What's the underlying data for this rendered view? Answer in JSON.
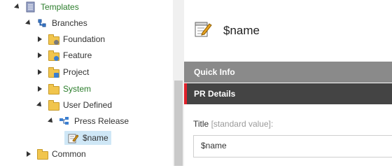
{
  "tree": {
    "templates": "Templates",
    "branches": "Branches",
    "foundation": "Foundation",
    "feature": "Feature",
    "project": "Project",
    "system": "System",
    "user_defined": "User Defined",
    "press_release": "Press Release",
    "name_item": "$name",
    "common": "Common"
  },
  "header": {
    "title": "$name"
  },
  "sections": {
    "quick_info": "Quick Info",
    "pr_details": "PR Details"
  },
  "field": {
    "label": "Title",
    "hint": "[standard value]:",
    "value": "$name"
  },
  "colors": {
    "quick_bg": "#8a8a8a",
    "pr_bg": "#444444",
    "accent": "#e0202a",
    "selected": "#cfe7f6"
  }
}
